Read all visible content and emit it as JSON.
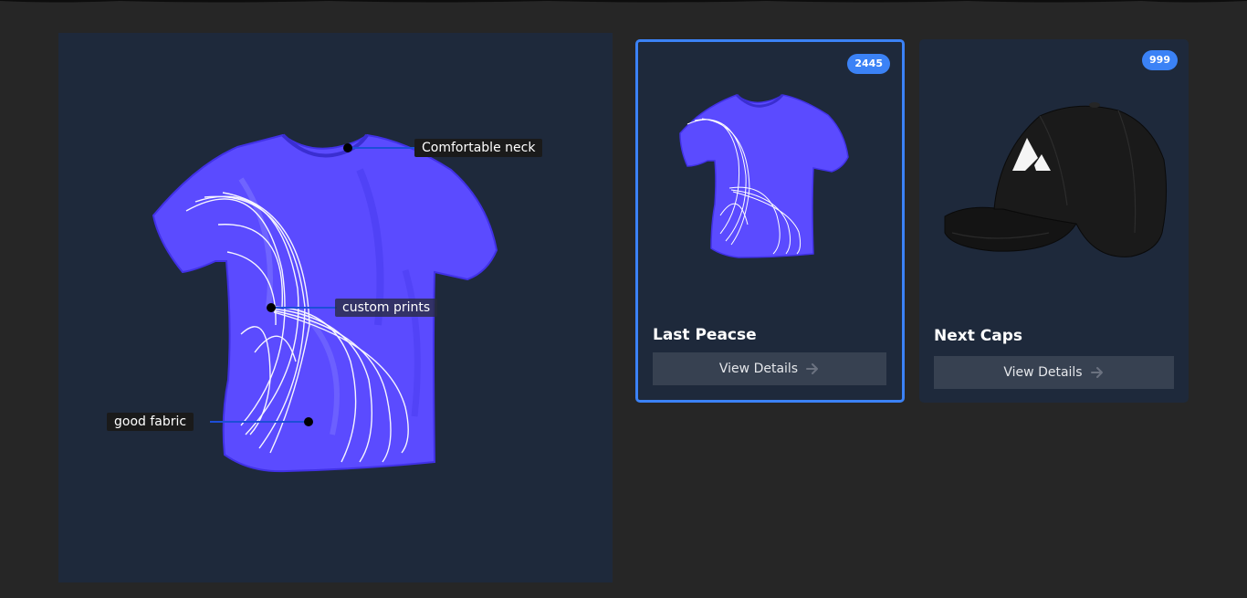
{
  "hero": {
    "hotspots": [
      {
        "label": "Comfortable neck"
      },
      {
        "label": "custom prints"
      },
      {
        "label": "good fabric"
      }
    ]
  },
  "products": [
    {
      "title": "Last Peacse",
      "badge": "2445",
      "button_label": "View Details",
      "image_icon": "tshirt-icon",
      "selected": true
    },
    {
      "title": "Next Caps",
      "badge": "999",
      "button_label": "View Details",
      "image_icon": "cap-icon",
      "selected": false
    }
  ],
  "colors": {
    "page_background": "#262626",
    "panel_background": "#1e293b",
    "accent": "#3b82f6",
    "shirt": "#5b4bff",
    "button_background": "#374151"
  }
}
